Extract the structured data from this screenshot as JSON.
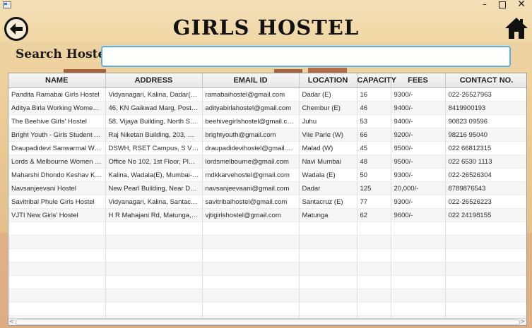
{
  "window": {
    "minimize_label": "–",
    "close_label": "✕"
  },
  "header": {
    "title": "GIRLS HOSTEL",
    "back_icon": "arrow-left-circle",
    "home_icon": "home"
  },
  "search": {
    "label": "Search Hostel",
    "value": "",
    "placeholder": ""
  },
  "table": {
    "columns": [
      "NAME",
      "ADDRESS",
      "EMAIL ID",
      "LOCATION",
      "CAPACITY",
      "FEES",
      "CONTACT NO."
    ],
    "rows": [
      [
        "Pandita Ramabai Girls Hostel",
        "Vidyanagari, Kalina, Dadar(E), ...",
        "ramabaihostel@gmail.com",
        "Dadar (E)",
        "16",
        "9300/-",
        "022-26527963"
      ],
      [
        "Aditya Birla Working Womens ...",
        "46, KN Gaikwad Marg, Postal C...",
        "adityabirlahostel@gmail.com",
        "Chembur (E)",
        "46",
        "9400/-",
        "8419900193"
      ],
      [
        "The Beehive Girls' Hostel",
        "58, Vijaya Building, North Sout...",
        "beehivegirlshostel@gmail.com",
        "Juhu",
        "53",
        "9400/-",
        "90823 09596"
      ],
      [
        "Bright Youth - Girls Student Ac...",
        "Raj Niketan Building, 203, Opti...",
        "brightyouth@gmail.com",
        "Vile Parle (W)",
        "66",
        "9200/-",
        "98216 95040"
      ],
      [
        "Draupadidevi Sanwarmal Wom...",
        "DSWH, RSET Campus, S V Rd, ...",
        "draupadidevihostel@gmail.com",
        "Malad (W)",
        "45",
        "9500/-",
        "022 66812315"
      ],
      [
        "Lords & Melbourne Women H...",
        "Office No 102, 1st Floor, Plot ...",
        "lordsmelbourne@gmail.com",
        "Navi Mumbai",
        "48",
        "9500/-",
        "022 6530 1113"
      ],
      [
        "Maharshi Dhondo Keshav Karv...",
        "Kalina, Wadala(E), Mumbai-40...",
        "mdkkarvehostel@gmail.com",
        "Wadala (E)",
        "50",
        "9300/-",
        "022-26526304"
      ],
      [
        "Navsanjeevani Hostel",
        "New Pearl Building, Near Dada...",
        "navsanjeevaani@gmail.com",
        "Dadar",
        "125",
        "20,000/-",
        "8789876543"
      ],
      [
        "Savitribai Phule Girls Hostel",
        "Vidyanagari, Kalina, Santacruz ...",
        "savitribaihostel@gmail.com",
        "Santacruz (E)",
        "77",
        "9300/-",
        "022-26526223"
      ],
      [
        "VJTI New Girls' Hostel",
        "H R Mahajani Rd, Matunga, M...",
        "vjtigirlshostel@gmail.com",
        "Matunga",
        "62",
        "9600/-",
        "022 24198155"
      ]
    ],
    "empty_rows": 9
  },
  "colors": {
    "search_border": "#5ab1e6",
    "accent": "#121212"
  }
}
